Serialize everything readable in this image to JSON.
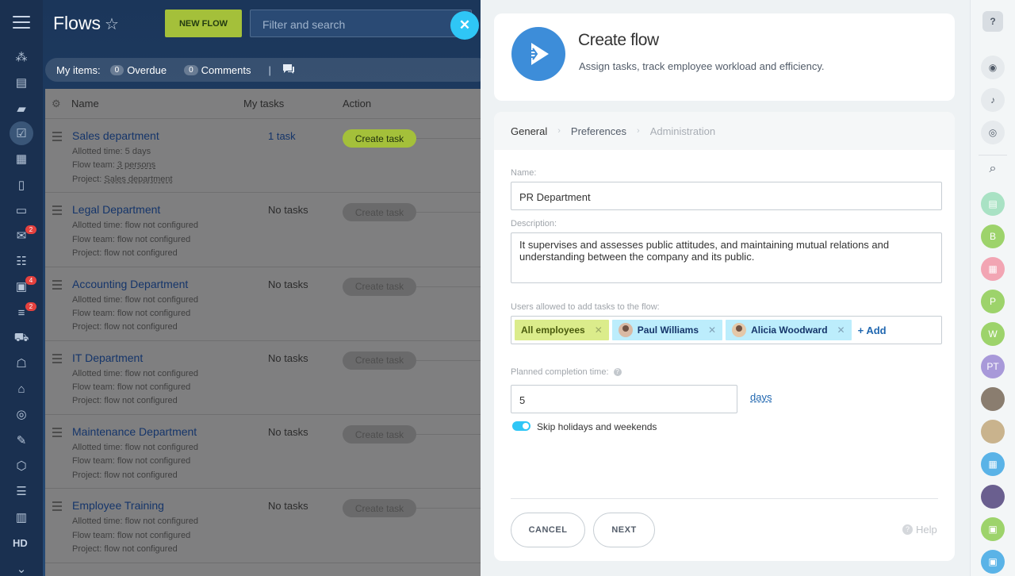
{
  "header": {
    "title": "Flows",
    "new_flow": "NEW FLOW",
    "filter_placeholder": "Filter and search"
  },
  "counters": {
    "my_items": "My items:",
    "overdue_count": "0",
    "overdue": "Overdue",
    "comments_count": "0",
    "comments": "Comments"
  },
  "left_badges": {
    "mail": "2",
    "contacts": "4",
    "crm": "2"
  },
  "left_hd": "HD",
  "grid": {
    "col_name": "Name",
    "col_tasks": "My tasks",
    "col_action": "Action",
    "rows": [
      {
        "name": "Sales department",
        "allotted": "5 days",
        "team": "3 persons",
        "project": "Sales department",
        "tasks": "1 task",
        "action": "Create task"
      },
      {
        "name": "Legal Department",
        "allotted": "flow not configured",
        "team": "flow not configured",
        "project": "flow not configured",
        "tasks": "No tasks",
        "action": "Create task"
      },
      {
        "name": "Accounting Department",
        "allotted": "flow not configured",
        "team": "flow not configured",
        "project": "flow not configured",
        "tasks": "No tasks",
        "action": "Create task"
      },
      {
        "name": "IT Department",
        "allotted": "flow not configured",
        "team": "flow not configured",
        "project": "flow not configured",
        "tasks": "No tasks",
        "action": "Create task"
      },
      {
        "name": "Maintenance Department",
        "allotted": "flow not configured",
        "team": "flow not configured",
        "project": "flow not configured",
        "tasks": "No tasks",
        "action": "Create task"
      },
      {
        "name": "Employee Training",
        "allotted": "flow not configured",
        "team": "flow not configured",
        "project": "flow not configured",
        "tasks": "No tasks",
        "action": "Create task"
      }
    ],
    "label_allotted": "Allotted time:",
    "label_team": "Flow team:",
    "label_project": "Project:"
  },
  "panel": {
    "title": "Create flow",
    "subtitle": "Assign tasks, track employee workload and efficiency.",
    "tabs": [
      "General",
      "Preferences",
      "Administration"
    ],
    "name_label": "Name:",
    "name_value": "PR Department",
    "desc_label": "Description:",
    "desc_value": "It supervises and assesses public attitudes, and maintaining mutual relations and understanding between the company and its public.",
    "users_label": "Users allowed to add tasks to the flow:",
    "users": [
      "All employees",
      "Paul Williams",
      "Alicia Woodward"
    ],
    "add_label": "+ Add",
    "completion_label": "Planned completion time:",
    "completion_value": "5",
    "days": "days",
    "skip_label": "Skip holidays and weekends",
    "cancel": "CANCEL",
    "next": "NEXT",
    "help": "Help"
  },
  "rightbar": {
    "help": "?",
    "avatars": [
      "B",
      "P",
      "W",
      "PT"
    ]
  }
}
